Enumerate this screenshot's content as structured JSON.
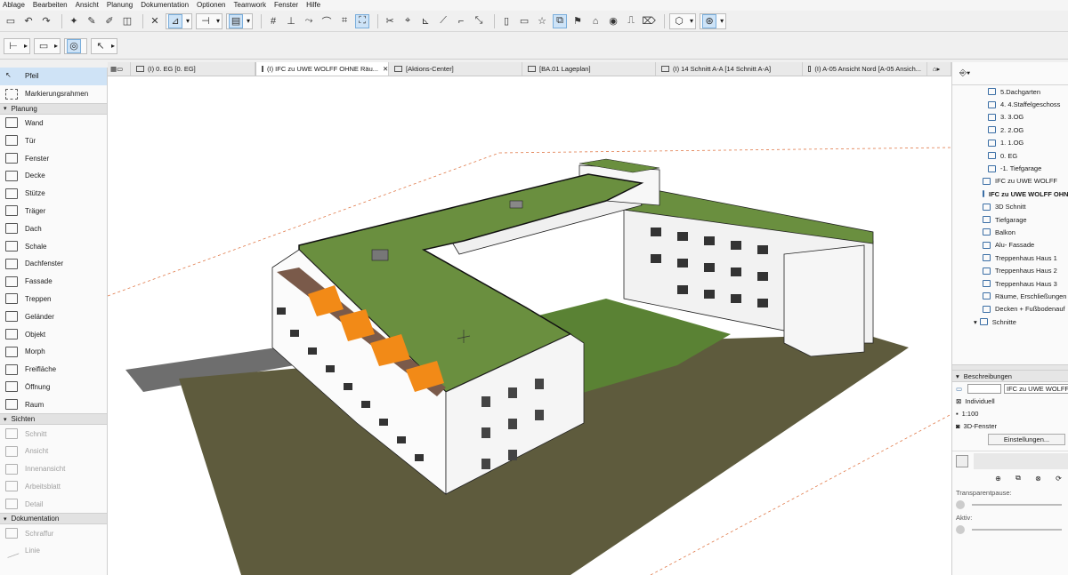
{
  "menu": [
    "Ablage",
    "Bearbeiten",
    "Ansicht",
    "Planung",
    "Dokumentation",
    "Optionen",
    "Teamwork",
    "Fenster",
    "Hilfe"
  ],
  "toolbox": {
    "top_tools": [
      {
        "label": "Pfeil",
        "icon": "arrow-pointer-icon",
        "selected": true
      },
      {
        "label": "Markierungsrahmen",
        "icon": "marquee-icon",
        "selected": false
      }
    ],
    "sections": [
      {
        "title": "Planung",
        "tools": [
          "Wand",
          "Tür",
          "Fenster",
          "Decke",
          "Stütze",
          "Träger",
          "Dach",
          "Schale",
          "Dachfenster",
          "Fassade",
          "Treppen",
          "Geländer",
          "Objekt",
          "Morph",
          "Freifläche",
          "Öffnung",
          "Raum"
        ],
        "disabled": false
      },
      {
        "title": "Sichten",
        "tools": [
          "Schnitt",
          "Ansicht",
          "Innenansicht",
          "Arbeitsblatt",
          "Detail"
        ],
        "disabled": true
      },
      {
        "title": "Dokumentation",
        "tools": [
          "Schraffur",
          "Linie"
        ],
        "disabled": true
      }
    ]
  },
  "tabs": [
    {
      "label": "(I) 0. EG [0. EG]",
      "active": false
    },
    {
      "label": "(I) IFC zu UWE WOLFF OHNE Räu...",
      "active": true,
      "closable": true
    },
    {
      "label": "[Aktions-Center]",
      "active": false
    },
    {
      "label": "[BA.01  Lageplan]",
      "active": false
    },
    {
      "label": "(I) 14 Schnitt A-A [14 Schnitt A-A]",
      "active": false
    },
    {
      "label": "(I) A-05 Ansicht Nord [A-05 Ansich...",
      "active": false
    }
  ],
  "navigator": {
    "nodes": [
      {
        "label": "5.Dachgarten",
        "indent": 2,
        "type": "story"
      },
      {
        "label": "4. 4.Staffelgeschoss",
        "indent": 2,
        "type": "story"
      },
      {
        "label": "3. 3.OG",
        "indent": 2,
        "type": "story"
      },
      {
        "label": "2. 2.OG",
        "indent": 2,
        "type": "story"
      },
      {
        "label": "1. 1.OG",
        "indent": 2,
        "type": "story"
      },
      {
        "label": "0. EG",
        "indent": 2,
        "type": "story"
      },
      {
        "label": "-1. Tiefgarage",
        "indent": 2,
        "type": "story"
      },
      {
        "label": "IFC zu UWE WOLFF",
        "indent": 1,
        "type": "view"
      },
      {
        "label": "IFC zu UWE WOLFF OHNE",
        "indent": 1,
        "type": "view",
        "bold": true
      },
      {
        "label": "3D Schnitt",
        "indent": 1,
        "type": "view"
      },
      {
        "label": "Tiefgarage",
        "indent": 1,
        "type": "view"
      },
      {
        "label": "Balkon",
        "indent": 1,
        "type": "view"
      },
      {
        "label": "Alu- Fassade",
        "indent": 1,
        "type": "view"
      },
      {
        "label": "Treppenhaus Haus 1",
        "indent": 1,
        "type": "view"
      },
      {
        "label": "Treppenhaus Haus 2",
        "indent": 1,
        "type": "view"
      },
      {
        "label": "Treppenhaus Haus 3",
        "indent": 1,
        "type": "view"
      },
      {
        "label": "Räume, Erschließungen",
        "indent": 1,
        "type": "view"
      },
      {
        "label": "Decken + Fußbodenauf",
        "indent": 1,
        "type": "view"
      },
      {
        "label": "Schnitte",
        "indent": 0,
        "type": "folder"
      }
    ]
  },
  "properties": {
    "header": "Beschreibungen",
    "name_value": "IFC zu UWE WOLFF O",
    "mode": "Individuell",
    "scale": "1:100",
    "window": "3D-Fenster",
    "settings_button": "Einstellungen...",
    "transparency_label": "Transparentpause:",
    "active_label": "Aktiv:"
  },
  "colors": {
    "roof_green": "#6a8f3f",
    "facade_white": "#f4f4f4",
    "ground_brown": "#5a5a3c",
    "balcony_orange": "#f28a17",
    "selection_blue": "#cfe3f6"
  }
}
